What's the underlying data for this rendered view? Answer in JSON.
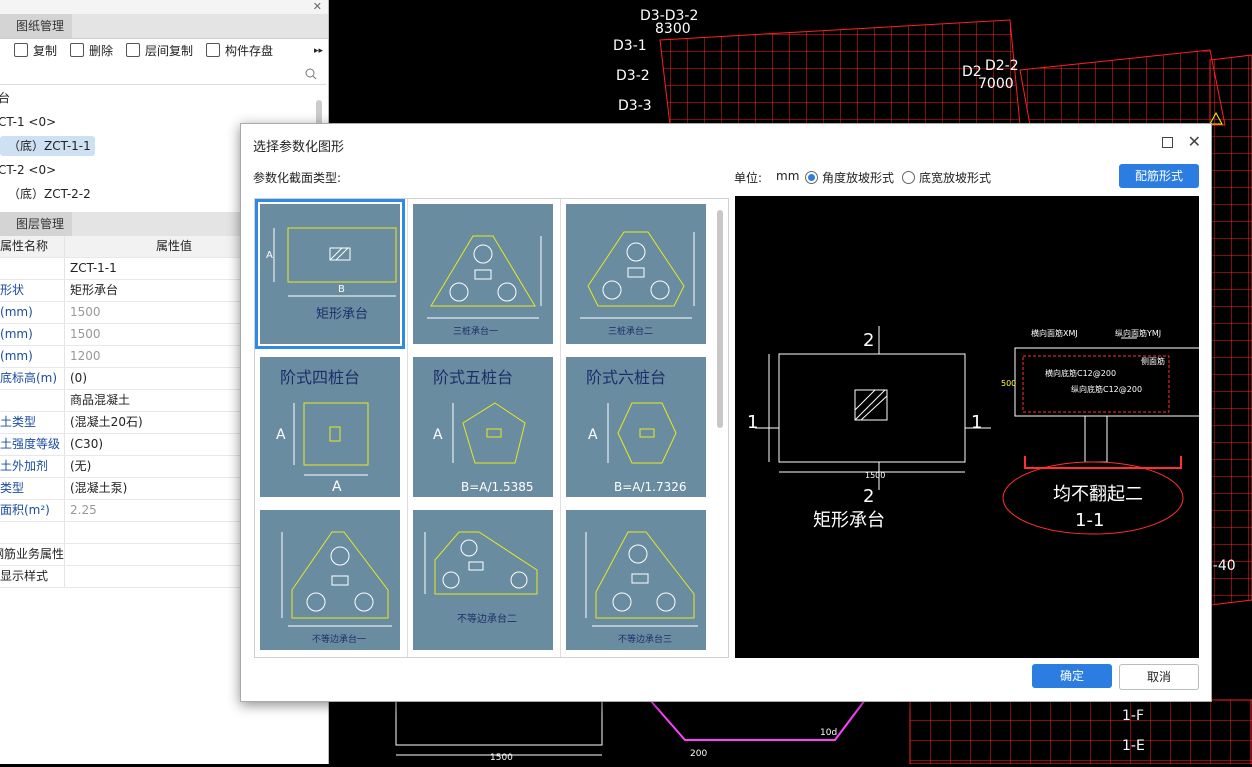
{
  "drawing_panel": {
    "tab": "图纸管理",
    "toolbar": {
      "copy": "复制",
      "delete": "删除",
      "floor_copy": "层间复制",
      "save": "构件存盘"
    },
    "tree": [
      "台",
      "CT-1 <0>",
      "（底）ZCT-1-1",
      "CT-2 <0>",
      "（底）ZCT-2-2"
    ]
  },
  "layer_panel": {
    "tab": "图层管理",
    "table": {
      "col_name": "属性名称",
      "col_value": "属性值",
      "rows": [
        {
          "name": "",
          "value": "ZCT-1-1",
          "gray": false
        },
        {
          "name": "形状",
          "value": "矩形承台",
          "gray": false
        },
        {
          "name": "(mm)",
          "value": "1500",
          "gray": true
        },
        {
          "name": "(mm)",
          "value": "1500",
          "gray": true
        },
        {
          "name": "(mm)",
          "value": "1200",
          "gray": true
        },
        {
          "name": "底标高(m)",
          "value": "(0)",
          "gray": false
        },
        {
          "name": "",
          "value": "商品混凝土",
          "gray": false
        },
        {
          "name": "土类型",
          "value": "(混凝土20石)",
          "gray": false
        },
        {
          "name": "土强度等级",
          "value": "(C30)",
          "gray": false
        },
        {
          "name": "土外加剂",
          "value": "(无)",
          "gray": false
        },
        {
          "name": "类型",
          "value": "(混凝土泵)",
          "gray": false
        },
        {
          "name": "面积(m²)",
          "value": "2.25",
          "gray": true
        },
        {
          "name": "",
          "value": "",
          "gray": false
        },
        {
          "name": "钢筋业务属性",
          "value": "",
          "gray": false
        },
        {
          "name": "显示样式",
          "value": "",
          "gray": false
        }
      ]
    }
  },
  "cad": {
    "labels": [
      "D3-D3-2",
      "8300",
      "D3-1",
      "D3-2",
      "D3-3",
      "D2",
      "D2-2",
      "7000",
      "1500",
      "200",
      "1-F",
      "1-E",
      "10d",
      "D-40"
    ]
  },
  "dialog": {
    "title": "选择参数化图形",
    "section_label": "参数化截面类型:",
    "unit_label": "单位:",
    "unit_value": "mm",
    "radio_angle": "角度放坡形式",
    "radio_width": "底宽放坡形式",
    "rebar_button": "配筋形式",
    "ok": "确定",
    "cancel": "取消",
    "shapes": [
      "矩形承台",
      "三桩承台一",
      "三桩承台二",
      "阶式四桩台",
      "阶式五桩台",
      "阶式六桩台",
      "不等边承台一",
      "不等边承台二",
      "不等边承台三"
    ],
    "shape_notes": {
      "five": "B=A/1.5385",
      "six": "B=A/1.7326"
    },
    "preview": {
      "sec_label": "2",
      "side_label": "1",
      "dim": "1500",
      "name": "矩形承台",
      "section_title": "1-1",
      "note": "均不翻起二",
      "h_rebar": "横向面筋XMJ",
      "v_rebar": "纵向面筋YMJ",
      "h_bottom": "横向底筋C12@200",
      "v_bottom": "纵向底筋C12@200",
      "side_rebar": "侧面筋",
      "depth": "500"
    }
  },
  "colors": {
    "accent": "#2c7de2",
    "cad_grid": "#ff2020",
    "cell_bg": "#6a8ca0",
    "shape_line": "#e8e820"
  }
}
